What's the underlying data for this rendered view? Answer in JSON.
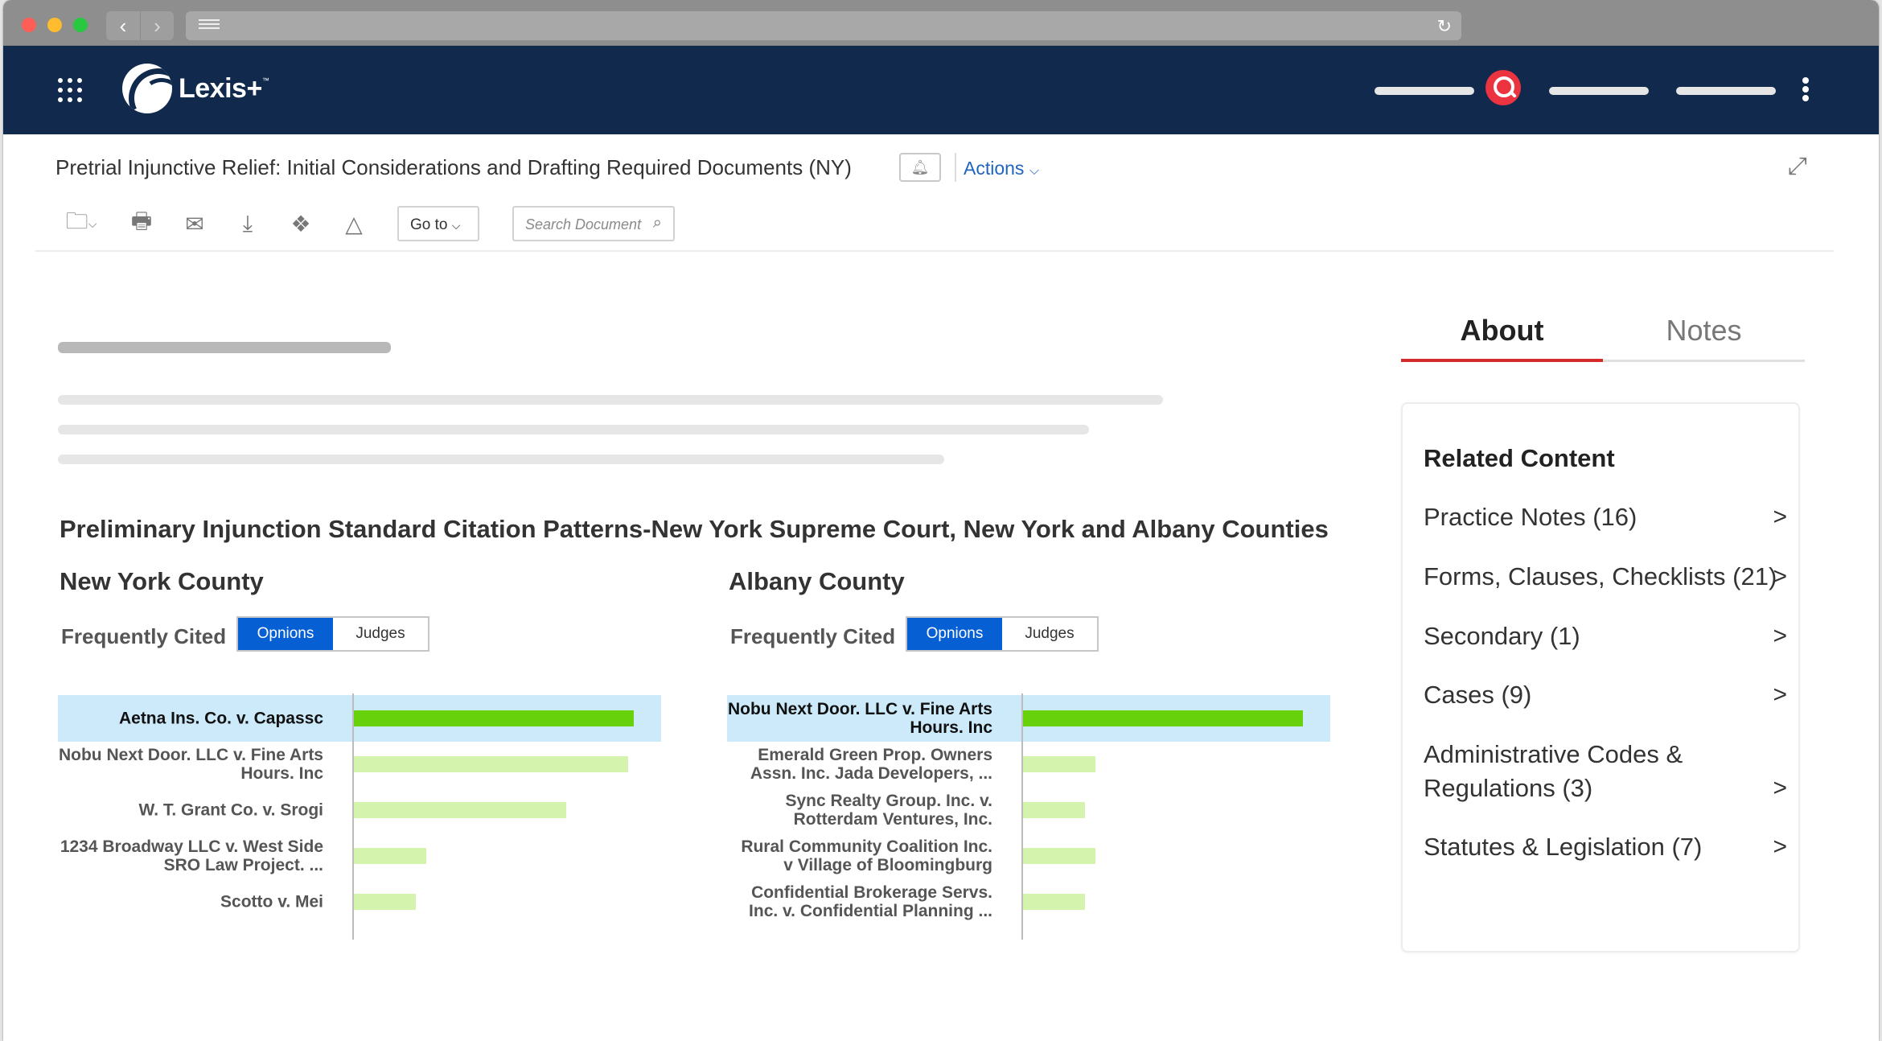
{
  "app": {
    "name": "Lexis+",
    "trademark": "™"
  },
  "document": {
    "title": "Pretrial Injunctive Relief: Initial Considerations and Drafting Required Documents (NY)",
    "actions_label": "Actions",
    "goto_label": "Go to",
    "search_placeholder": "Search Document"
  },
  "icons": {
    "folder": "folder-icon",
    "print": "print-icon",
    "email": "envelope-icon",
    "download": "download-icon",
    "dropbox": "dropbox-icon",
    "drive": "google-drive-icon",
    "bell": "bell-icon",
    "expand": "expand-icon",
    "search": "search-icon"
  },
  "colors": {
    "header_bg": "#10294d",
    "accent_red": "#ec3340",
    "toggle_blue": "#0660d4",
    "bar_top": "#67d20b",
    "bar": "#d4f3ac",
    "highlight_row": "#cdeafa"
  },
  "chart_section": {
    "title": "Preliminary Injunction Standard Citation Patterns-New York Supreme Court, New York and Albany Counties",
    "frequently_cited_label": "Frequently Cited",
    "toggle": {
      "opinions": "Opnions",
      "judges": "Judges",
      "selected": "Opnions"
    }
  },
  "chart_data": [
    {
      "type": "bar",
      "orientation": "horizontal",
      "title": "New York County",
      "categories": [
        "Aetna Ins. Co. v. Capassc",
        "Nobu Next Door. LLC v. Fine Arts Hours. Inc",
        "W. T. Grant Co. v. Srogi",
        "1234 Broadway LLC v. West Side SRO Law Project. ...",
        "Scotto v. Mei"
      ],
      "values": [
        100,
        98,
        76,
        26,
        22
      ],
      "highlighted": 0,
      "xlim": [
        0,
        112
      ],
      "grid": false
    },
    {
      "type": "bar",
      "orientation": "horizontal",
      "title": "Albany County",
      "categories": [
        "Nobu Next Door. LLC v. Fine Arts Hours. Inc",
        "Emerald Green Prop. Owners Assn. Inc. Jada Developers, ...",
        "Sync Realty Group. Inc. v. Rotterdam Ventures, Inc.",
        "Rural Community Coalition Inc. v Village of Bloomingburg",
        "Confidential Brokerage Servs. Inc. v. Confidential Planning ..."
      ],
      "values": [
        100,
        26,
        22,
        26,
        22
      ],
      "highlighted": 0,
      "xlim": [
        0,
        112
      ],
      "grid": false
    }
  ],
  "sidebar": {
    "tabs": [
      {
        "label": "About",
        "active": true
      },
      {
        "label": "Notes",
        "active": false
      }
    ],
    "related_title": "Related Content",
    "items": [
      {
        "label": "Practice Notes (16)"
      },
      {
        "label": "Forms, Clauses, Checklists (21)"
      },
      {
        "label": "Secondary (1)"
      },
      {
        "label": "Cases (9)"
      },
      {
        "label": "Administrative Codes & Regulations (3)"
      },
      {
        "label": "Statutes & Legislation (7)"
      }
    ],
    "chevron": ">"
  }
}
